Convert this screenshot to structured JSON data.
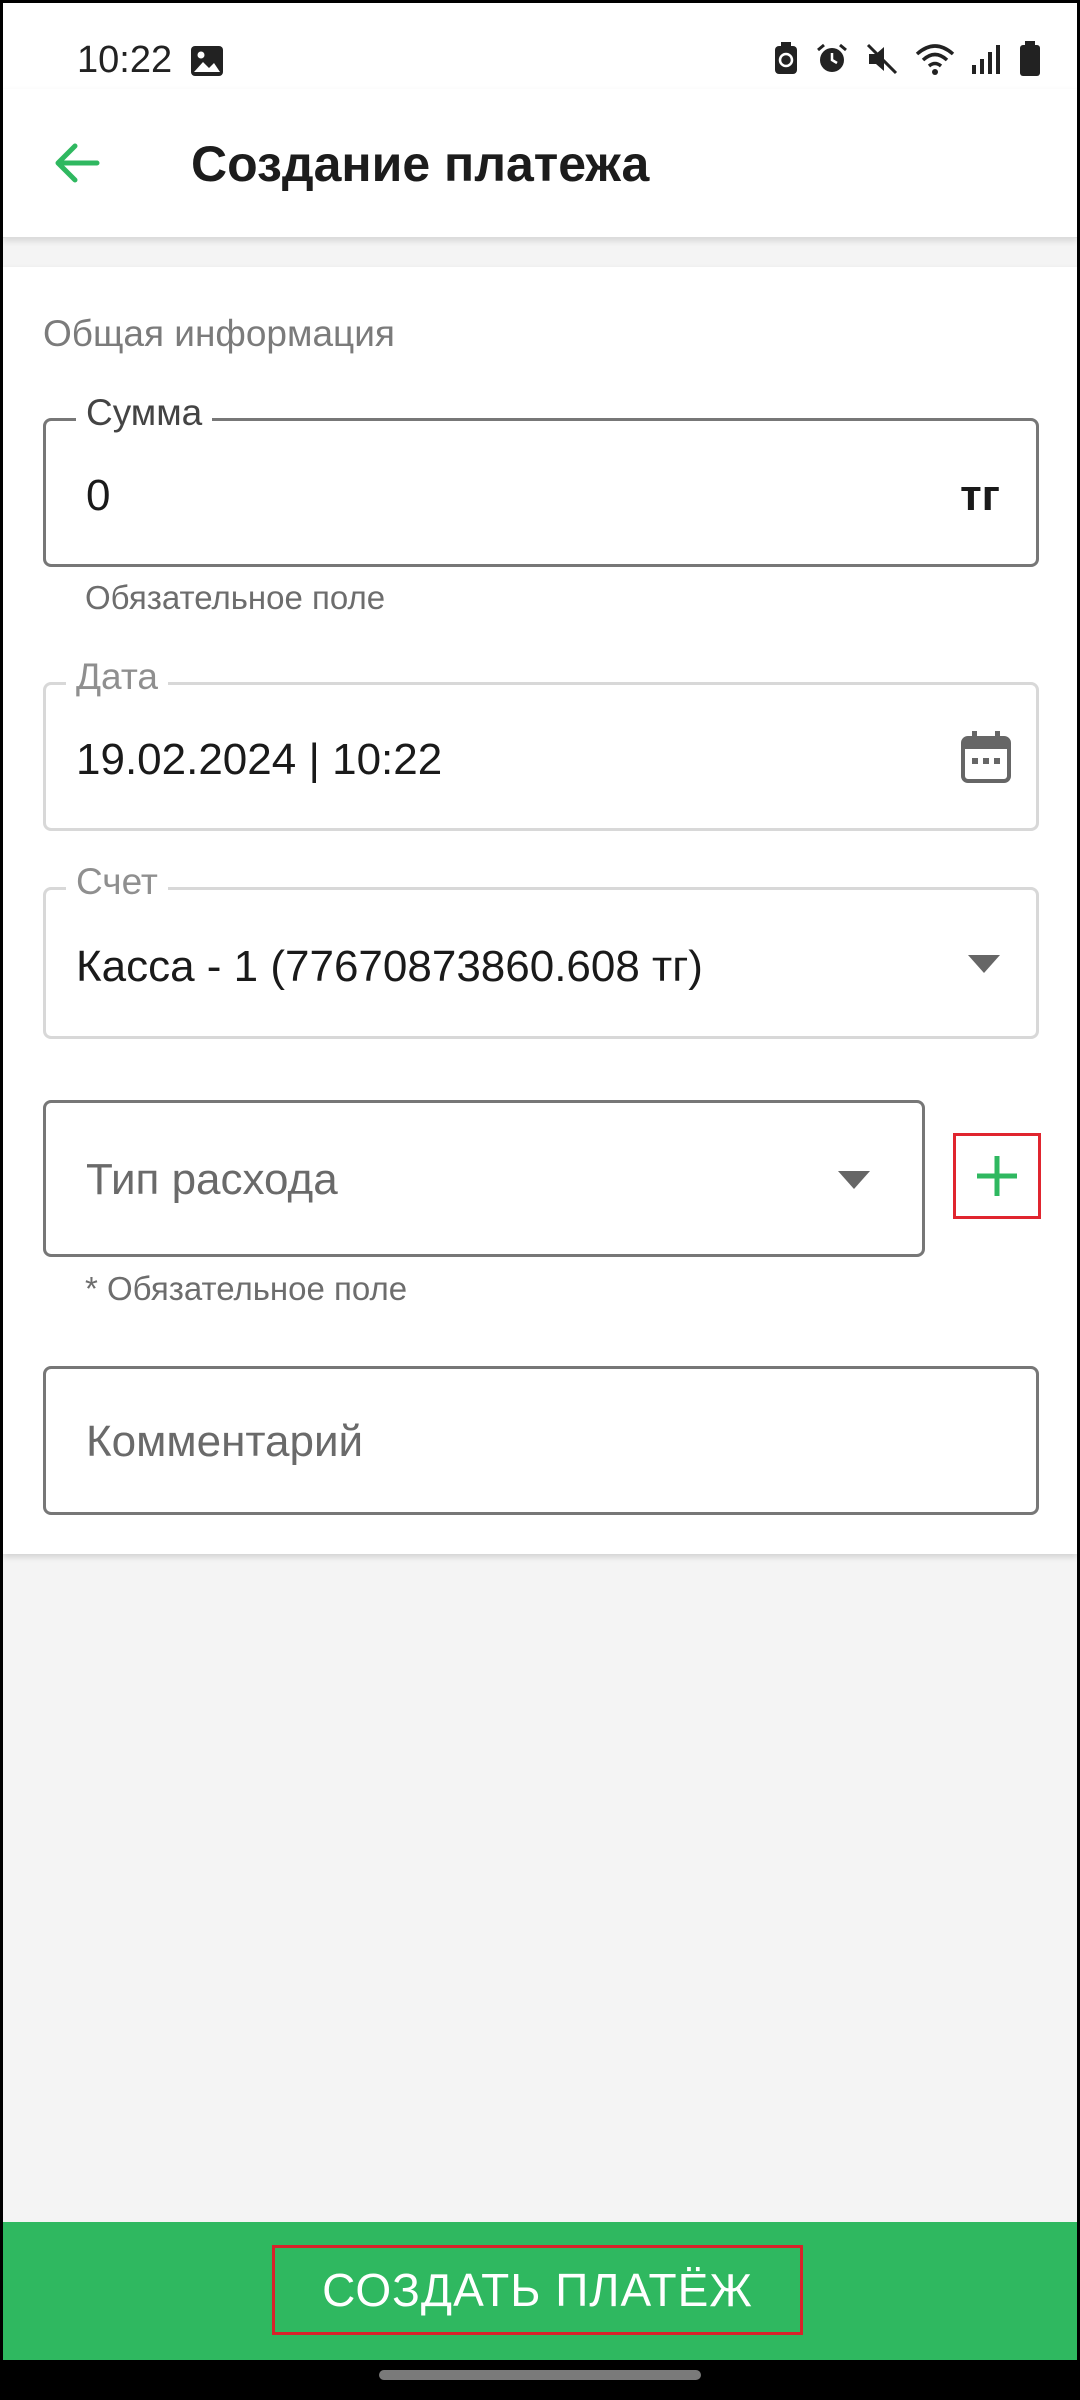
{
  "status_bar": {
    "time": "10:22",
    "icons": [
      "photo-icon",
      "battery-saver-icon",
      "alarm-icon",
      "mute-icon",
      "wifi-icon",
      "signal-icon",
      "battery-icon"
    ]
  },
  "app_bar": {
    "title": "Создание платежа",
    "back_icon": "arrow-left-icon",
    "accent_color": "#2fb860"
  },
  "form": {
    "section_title": "Общая информация",
    "amount": {
      "label": "Сумма",
      "value": "0",
      "currency": "тг",
      "helper": "Обязательное поле"
    },
    "date": {
      "label": "Дата",
      "value": "19.02.2024 | 10:22",
      "icon": "calendar-icon"
    },
    "account": {
      "label": "Счет",
      "value": "Касса - 1 (77670873860.608 тг)",
      "icon": "dropdown-caret-icon"
    },
    "expense_type": {
      "placeholder": "Тип расхода",
      "helper": "* Обязательное поле",
      "icon": "dropdown-caret-icon",
      "add_icon": "plus-icon"
    },
    "comment": {
      "placeholder": "Комментарий"
    }
  },
  "footer": {
    "create_label": "СОЗДАТЬ ПЛАТЁЖ",
    "button_color": "#2fb860",
    "highlight_color": "#e0252f"
  }
}
